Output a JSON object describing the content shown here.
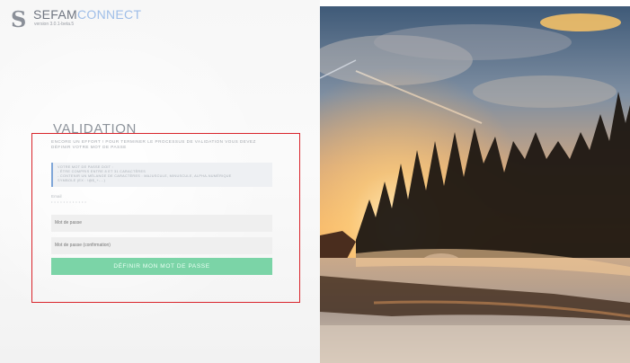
{
  "app": {
    "brand_part1": "SEFAM",
    "brand_part2": "CONNECT",
    "version": "version 3.0.1-beta.5"
  },
  "validation": {
    "title": "VALIDATION",
    "intro": "ENCORE UN EFFORT ! POUR TERMINER LE PROCESSUS DE VALIDATION VOUS DEVEZ DÉFINIR VOTRE MOT DE PASSE",
    "info_lines": [
      "VOTRE MOT DE PASSE DOIT :",
      "- ÊTRE COMPRIS ENTRE 8 ET 31 CARACTÈRES",
      "- CONTENIR UN MÉLANGE DE CARACTÈRES : MAJUSCULE, MINUSCULE, ALPHA-NUMÉRIQUE",
      "  SYMBOLE (EX : !@$_+-...)"
    ],
    "email_label": "Email",
    "email_value": "••••••••••••",
    "password_placeholder": "Mot de passe",
    "password_confirm_placeholder": "Mot de passe (confirmation)",
    "submit_label": "DÉFINIR MON MOT DE PASSE"
  },
  "colors": {
    "accent_green": "#7bd4a7",
    "brand_blue": "#9fbee8",
    "highlight_red": "#d9242b"
  }
}
